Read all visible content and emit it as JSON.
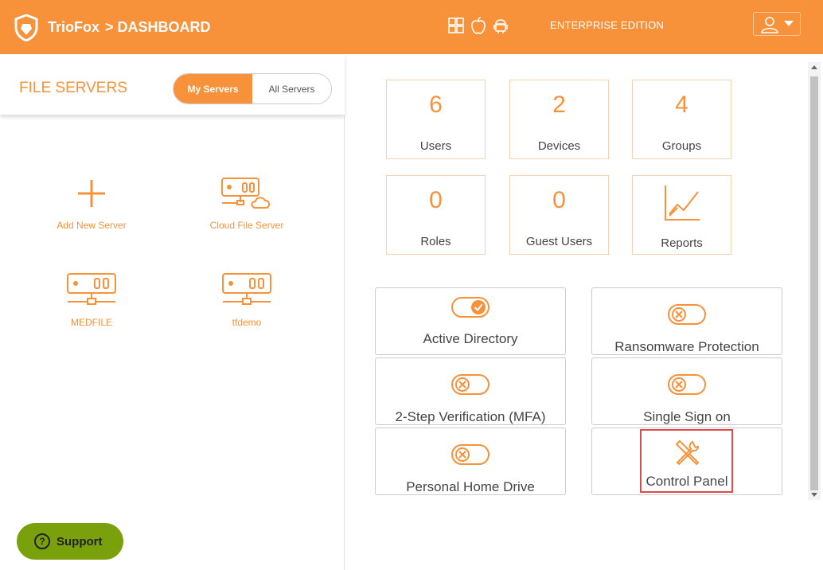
{
  "header": {
    "brand": "TrioFox",
    "breadcrumb": "> DASHBOARD",
    "edition": "ENTERPRISE EDITION",
    "platform_icons": [
      "windows-icon",
      "apple-icon",
      "android-icon"
    ],
    "user_icon": "user-icon",
    "background": "#f7923a"
  },
  "file_servers": {
    "title": "FILE SERVERS",
    "tabs": [
      "My Servers",
      "All Servers"
    ],
    "active_tab": "My Servers",
    "items": [
      {
        "label": "Add New Server",
        "icon": "plus-icon"
      },
      {
        "label": "Cloud File Server",
        "icon": "cloud-server-icon"
      },
      {
        "label": "MEDFILE",
        "icon": "server-icon"
      },
      {
        "label": "tfdemo",
        "icon": "server-icon"
      }
    ]
  },
  "support": {
    "label": "Support",
    "color": "#7aa10c"
  },
  "stats": [
    {
      "value": "6",
      "label": "Users"
    },
    {
      "value": "2",
      "label": "Devices"
    },
    {
      "value": "4",
      "label": "Groups"
    },
    {
      "value": "0",
      "label": "Roles"
    },
    {
      "value": "0",
      "label": "Guest Users"
    },
    {
      "value": "",
      "label": "Reports",
      "icon": "chart-icon"
    }
  ],
  "features": [
    {
      "label": "Active Directory",
      "status": "enabled"
    },
    {
      "label": "Ransomware Protection",
      "status": "disabled"
    },
    {
      "label": "2-Step Verification (MFA)",
      "status": "disabled"
    },
    {
      "label": "Single Sign on",
      "status": "disabled"
    },
    {
      "label": "Personal Home Drive",
      "status": "disabled"
    },
    {
      "label": "Control Panel",
      "icon": "tools-icon",
      "highlighted": true
    }
  ],
  "accent_color": "#f7923a",
  "highlight_color": "#e04a4a"
}
